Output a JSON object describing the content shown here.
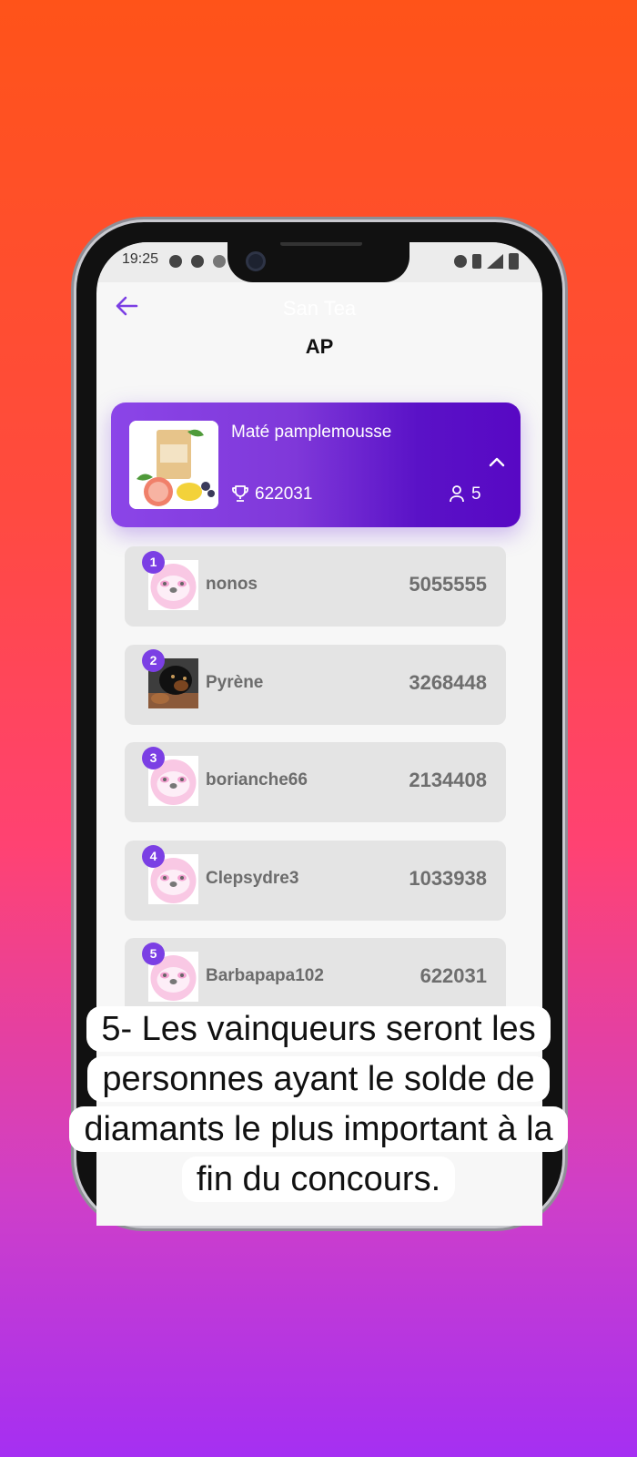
{
  "status_bar": {
    "time": "19:25"
  },
  "header": {
    "app_name": "San Tea",
    "page_title": "AP"
  },
  "contest": {
    "product_name": "Maté pamplemousse",
    "prize_value": "622031",
    "participants": "5"
  },
  "leaderboard": [
    {
      "rank": "1",
      "name": "nonos",
      "score": "5055555",
      "avatar": "sloth"
    },
    {
      "rank": "2",
      "name": "Pyrène",
      "score": "3268448",
      "avatar": "dog-photo"
    },
    {
      "rank": "3",
      "name": "borianche66",
      "score": "2134408",
      "avatar": "sloth"
    },
    {
      "rank": "4",
      "name": "Clepsydre3",
      "score": "1033938",
      "avatar": "sloth"
    },
    {
      "rank": "5",
      "name": "Barbapapa102",
      "score": "622031",
      "avatar": "sloth"
    }
  ],
  "caption": {
    "line1": "5- Les vainqueurs seront les",
    "line2": "personnes ayant le solde de",
    "line3": "diamants le plus important à la",
    "line4": "fin du concours."
  },
  "colors": {
    "accent": "#7b3fe4",
    "card_gradient_start": "#8b45e8",
    "card_gradient_end": "#5808c4"
  }
}
